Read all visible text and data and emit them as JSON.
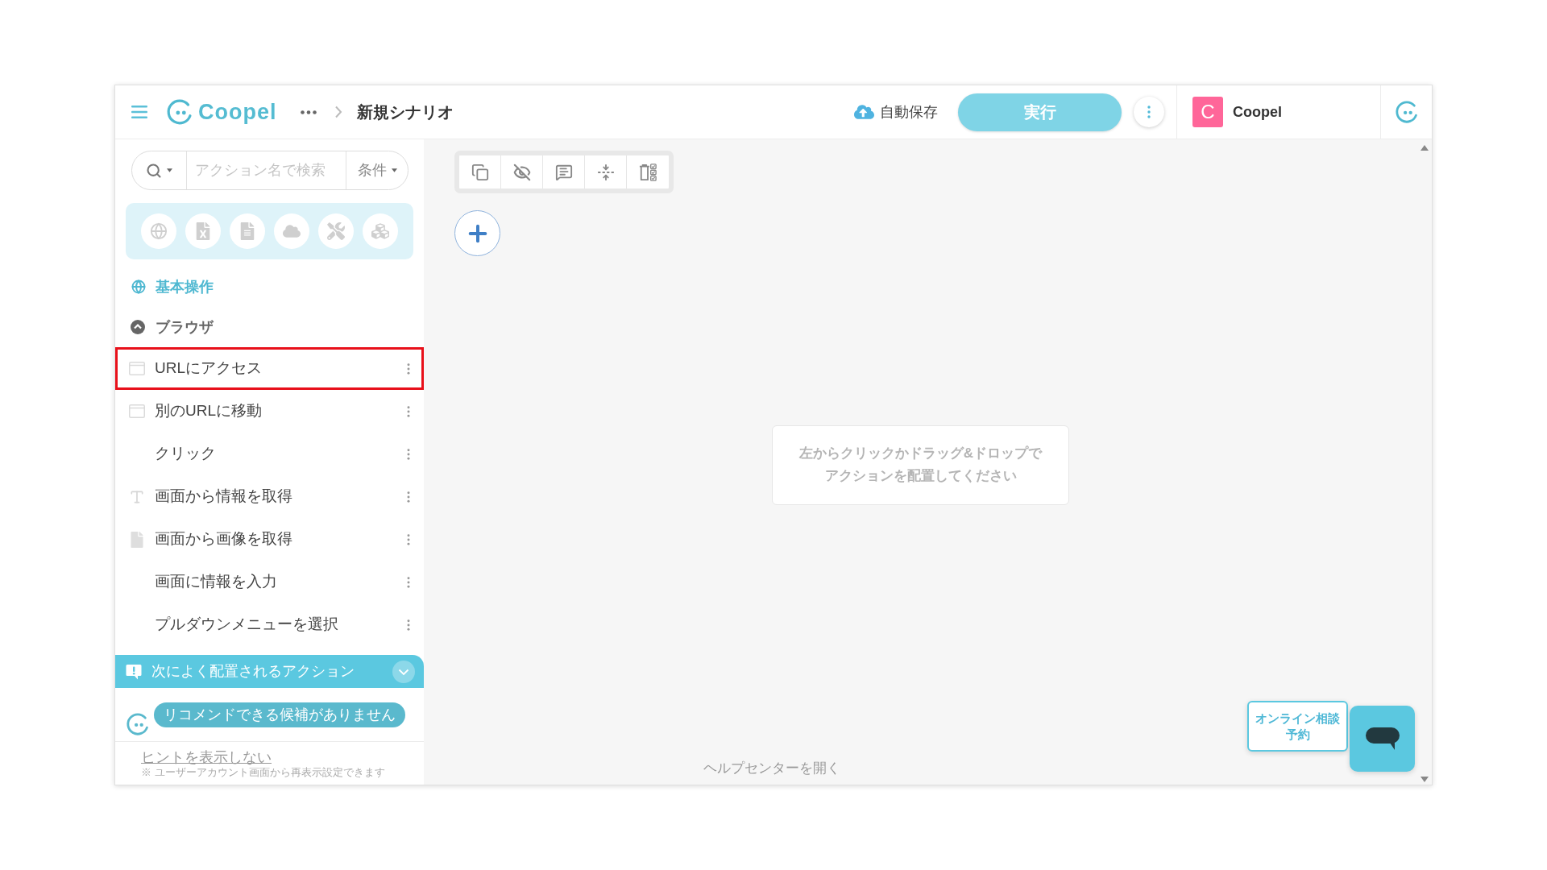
{
  "header": {
    "logo": "Coopel",
    "scenario_title": "新規シナリオ",
    "autosave": "自動保存",
    "run_button": "実行",
    "user": {
      "initial": "C",
      "name": "Coopel"
    }
  },
  "sidebar": {
    "search": {
      "placeholder": "アクション名で検索",
      "filter": "条件"
    },
    "category_title": "基本操作",
    "group": {
      "title": "ブラウザ",
      "expanded": true
    },
    "actions": [
      {
        "label": "URLにアクセス",
        "kind": "window",
        "highlighted": true
      },
      {
        "label": "別のURLに移動",
        "kind": "window",
        "highlighted": false
      },
      {
        "label": "クリック",
        "kind": "plain",
        "highlighted": false
      },
      {
        "label": "画面から情報を取得",
        "kind": "text",
        "highlighted": false
      },
      {
        "label": "画面から画像を取得",
        "kind": "file",
        "highlighted": false
      },
      {
        "label": "画面に情報を入力",
        "kind": "plain",
        "highlighted": false
      },
      {
        "label": "プルダウンメニューを選択",
        "kind": "plain",
        "highlighted": false
      }
    ],
    "recommend": {
      "title": "次によく配置されるアクション",
      "message": "リコメンドできる候補がありません"
    },
    "hint": {
      "link": "ヒントを表示しない",
      "note": "※ ユーザーアカウント画面から再表示設定できます"
    }
  },
  "canvas": {
    "empty_message": [
      "左からクリックかドラッグ&ドロップで",
      "アクションを配置してください"
    ],
    "help_link": "ヘルプセンターを開く"
  },
  "support": {
    "booking_button": [
      "オンライン相談",
      "予約"
    ]
  }
}
